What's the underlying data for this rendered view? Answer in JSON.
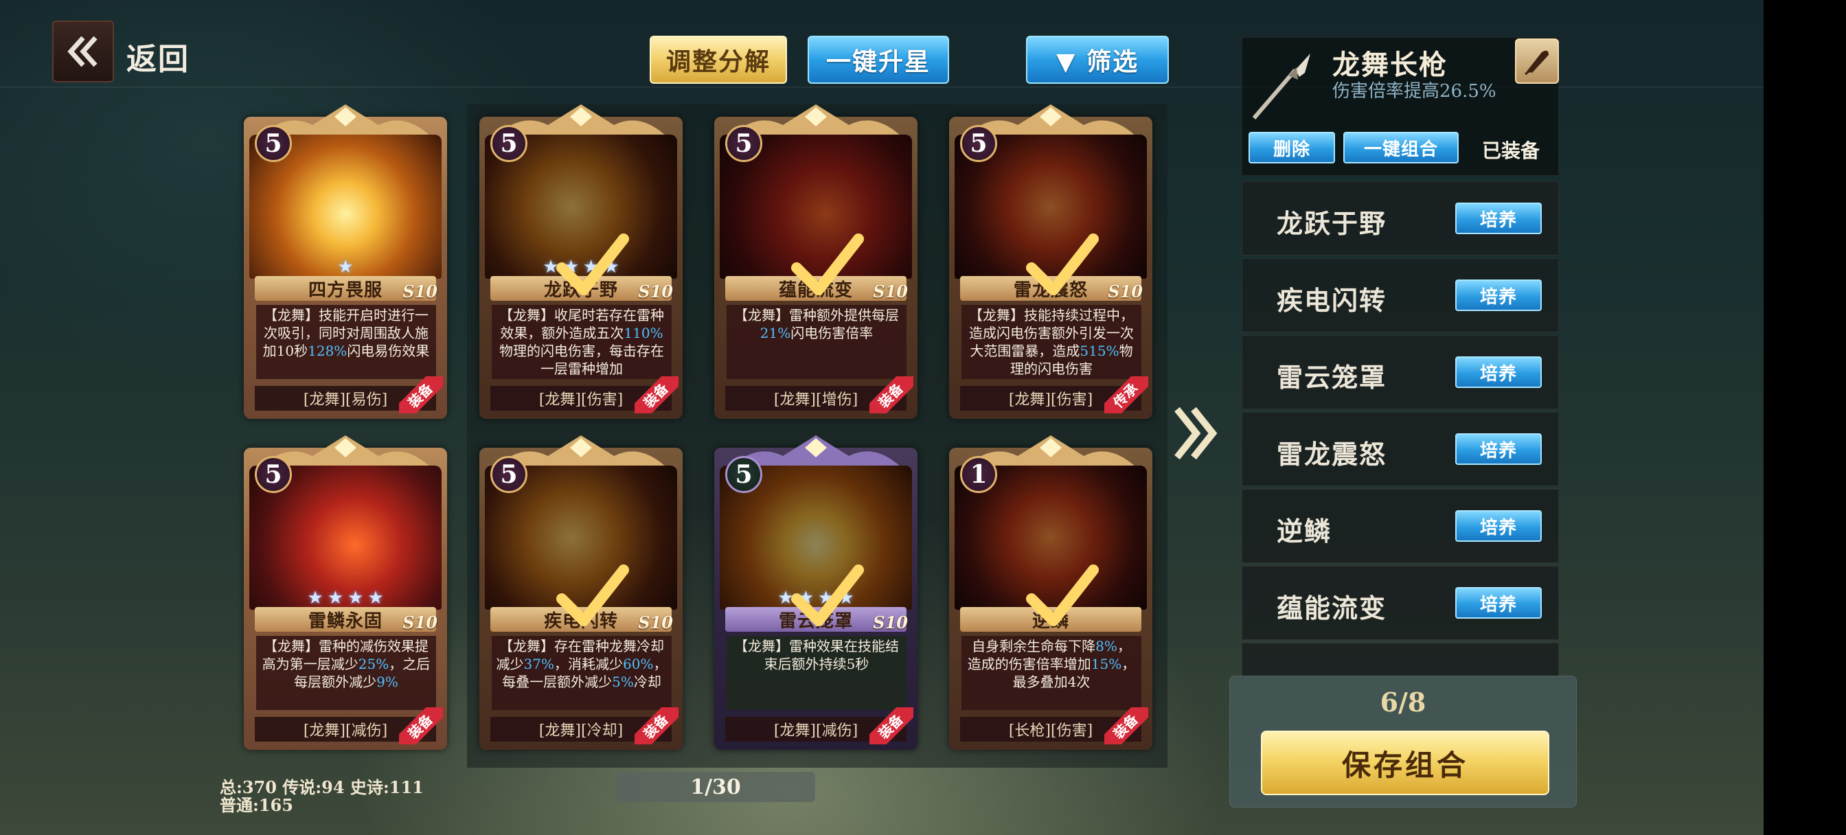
{
  "header": {
    "back_label": "返回",
    "buttons": {
      "adjust_dismantle": "调整分解",
      "one_click_star_up": "一键升星",
      "filter": "▼ 筛选"
    }
  },
  "cards": [
    {
      "level": "5",
      "name": "四方畏服",
      "tier": "S10",
      "stars": 1,
      "selected": false,
      "desc": "【龙舞】技能开启时进行一次吸引，同时对周围敌人施加10秒128%闪电易伤效果",
      "tags": "[龙舞][易伤]",
      "badge": "装备"
    },
    {
      "level": "5",
      "name": "龙跃于野",
      "tier": "S10",
      "stars": 4,
      "selected": true,
      "desc": "【龙舞】收尾时若存在雷种效果，额外造成五次110%物理的闪电伤害，每击存在一层雷种增加",
      "tags": "[龙舞][伤害]",
      "badge": "装备"
    },
    {
      "level": "5",
      "name": "蕴能流变",
      "tier": "S10",
      "stars": 0,
      "selected": true,
      "desc": "【龙舞】雷种额外提供每层21%闪电伤害倍率",
      "tags": "[龙舞][增伤]",
      "badge": "装备"
    },
    {
      "level": "5",
      "name": "雷龙震怒",
      "tier": "S10",
      "stars": 0,
      "selected": true,
      "desc": "【龙舞】技能持续过程中，造成闪电伤害额外引发一次大范围雷暴，造成515%物理的闪电伤害",
      "tags": "[龙舞][伤害]",
      "badge": "传承"
    },
    {
      "level": "5",
      "name": "雷鳞永固",
      "tier": "S10",
      "stars": 4,
      "selected": false,
      "desc": "【龙舞】雷种的减伤效果提高为第一层减少25%，之后每层额外减少9%",
      "tags": "[龙舞][减伤]",
      "badge": "装备"
    },
    {
      "level": "5",
      "name": "疾电闪转",
      "tier": "S10",
      "stars": 0,
      "selected": true,
      "desc": "【龙舞】存在雷种龙舞冷却减少37%，消耗减少60%，每叠一层额外减少5%冷却",
      "tags": "[龙舞][冷却]",
      "badge": "装备"
    },
    {
      "level": "5",
      "name": "雷云笼罩",
      "tier": "S10",
      "stars": 4,
      "selected": true,
      "purple": true,
      "desc": "【龙舞】雷种效果在技能结束后额外持续5秒",
      "tags": "[龙舞][减伤]",
      "badge": "装备"
    },
    {
      "level": "1",
      "name": "逆鳞",
      "tier": "",
      "stars": 0,
      "selected": true,
      "desc": "自身剩余生命每下降8%，造成的伤害倍率增加15%，最多叠加4次",
      "tags": "[长枪][伤害]",
      "badge": "装备"
    }
  ],
  "stats": {
    "line1": "总:370 传说:94 史诗:111",
    "line2": "普通:165"
  },
  "pager": "1/30",
  "equipment": {
    "name": "龙舞长枪",
    "bonus": "伤害倍率提高26.5%",
    "delete_label": "删除",
    "combine_label": "一键组合",
    "status_label": "已装备"
  },
  "skill_list": [
    {
      "name": "龙跃于野",
      "action": "培养"
    },
    {
      "name": "疾电闪转",
      "action": "培养"
    },
    {
      "name": "雷云笼罩",
      "action": "培养"
    },
    {
      "name": "雷龙震怒",
      "action": "培养"
    },
    {
      "name": "逆鳞",
      "action": "培养"
    },
    {
      "name": "蕴能流变",
      "action": "培养"
    }
  ],
  "save": {
    "count": "6/8",
    "label": "保存组合"
  },
  "colors": {
    "gold_button": "#f3d26e",
    "blue_button": "#2a9fe6",
    "highlight_text": "#4fc0ff",
    "badge_red": "#d62a3a"
  }
}
